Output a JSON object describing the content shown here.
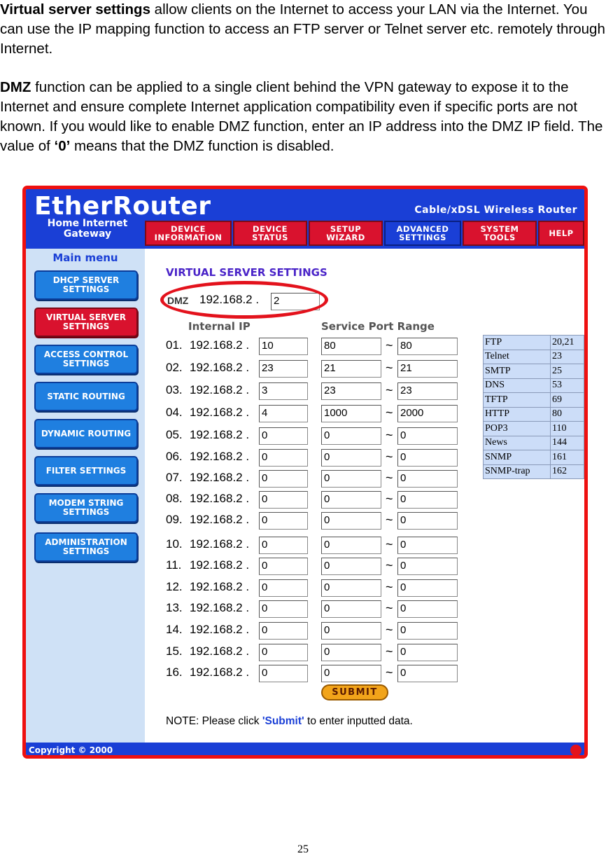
{
  "doc": {
    "p1_bold": "Virtual server settings",
    "p1_text": " allow clients on the Internet to access your LAN via the Internet. You can use the IP mapping function to access an FTP server or Telnet server etc. remotely through Internet.",
    "p2_bold": "DMZ",
    "p2_text": " function can be applied to a single client behind the VPN gateway to expose it to the Internet and ensure complete Internet application compatibility even if specific ports are not known. If you would like to enable DMZ function, enter an IP address into the DMZ IP field. The value of ",
    "p2_zero": "‘0’",
    "p2_tail": "  means that the DMZ function is disabled.",
    "page_number": "25"
  },
  "router": {
    "brand": "EtherRouter",
    "tagline": "Cable/xDSL Wireless Router",
    "home_gateway": "Home Internet Gateway",
    "nav": [
      {
        "label": "DEVICE INFORMATION"
      },
      {
        "label": "DEVICE STATUS"
      },
      {
        "label": "SETUP WIZARD"
      },
      {
        "label": "ADVANCED SETTINGS",
        "active": true
      },
      {
        "label": "SYSTEM TOOLS"
      },
      {
        "label": "HELP"
      }
    ],
    "main_menu_title": "Main menu",
    "menu": [
      {
        "label": "DHCP SERVER SETTINGS"
      },
      {
        "label": "VIRTUAL SERVER SETTINGS",
        "active": true
      },
      {
        "label": "ACCESS CONTROL SETTINGS"
      },
      {
        "label": "STATIC ROUTING"
      },
      {
        "label": "DYNAMIC ROUTING"
      },
      {
        "label": "FILTER SETTINGS"
      },
      {
        "label": "MODEM STRING SETTINGS"
      },
      {
        "label": "ADMINISTRATION SETTINGS"
      }
    ],
    "section_title": "VIRTUAL SERVER SETTINGS",
    "dmz": {
      "label": "DMZ",
      "prefix": "192.168.2 .",
      "value": "2"
    },
    "columns": {
      "internal_ip": "Internal IP",
      "port_range": "Service Port Range"
    },
    "rows": [
      {
        "num": "01.",
        "prefix": "192.168.2 .",
        "ip": "10",
        "start": "80",
        "end": "80"
      },
      {
        "num": "02.",
        "prefix": "192.168.2 .",
        "ip": "23",
        "start": "21",
        "end": "21"
      },
      {
        "num": "03.",
        "prefix": "192.168.2 .",
        "ip": "3",
        "start": "23",
        "end": "23"
      },
      {
        "num": "04.",
        "prefix": "192.168.2 .",
        "ip": "4",
        "start": "1000",
        "end": "2000"
      },
      {
        "num": "05.",
        "prefix": "192.168.2 .",
        "ip": "0",
        "start": "0",
        "end": "0"
      },
      {
        "num": "06.",
        "prefix": "192.168.2 .",
        "ip": "0",
        "start": "0",
        "end": "0"
      },
      {
        "num": "07.",
        "prefix": "192.168.2 .",
        "ip": "0",
        "start": "0",
        "end": "0"
      },
      {
        "num": "08.",
        "prefix": "192.168.2 .",
        "ip": "0",
        "start": "0",
        "end": "0"
      },
      {
        "num": "09.",
        "prefix": "192.168.2 .",
        "ip": "0",
        "start": "0",
        "end": "0"
      },
      {
        "num": "10.",
        "prefix": "192.168.2 .",
        "ip": "0",
        "start": "0",
        "end": "0"
      },
      {
        "num": "11.",
        "prefix": "192.168.2 .",
        "ip": "0",
        "start": "0",
        "end": "0"
      },
      {
        "num": "12.",
        "prefix": "192.168.2 .",
        "ip": "0",
        "start": "0",
        "end": "0"
      },
      {
        "num": "13.",
        "prefix": "192.168.2 .",
        "ip": "0",
        "start": "0",
        "end": "0"
      },
      {
        "num": "14.",
        "prefix": "192.168.2 .",
        "ip": "0",
        "start": "0",
        "end": "0"
      },
      {
        "num": "15.",
        "prefix": "192.168.2 .",
        "ip": "0",
        "start": "0",
        "end": "0"
      },
      {
        "num": "16.",
        "prefix": "192.168.2 .",
        "ip": "0",
        "start": "0",
        "end": "0"
      }
    ],
    "tilde": "~",
    "ports": [
      {
        "service": "FTP",
        "port": "20,21"
      },
      {
        "service": "Telnet",
        "port": "23"
      },
      {
        "service": "SMTP",
        "port": "25"
      },
      {
        "service": "DNS",
        "port": "53"
      },
      {
        "service": "TFTP",
        "port": "69"
      },
      {
        "service": "HTTP",
        "port": "80"
      },
      {
        "service": "POP3",
        "port": "110"
      },
      {
        "service": "News",
        "port": "144"
      },
      {
        "service": "SNMP",
        "port": "161"
      },
      {
        "service": "SNMP-trap",
        "port": "162"
      }
    ],
    "submit_label": "SUBMIT",
    "note_prefix": "NOTE: Please click ",
    "note_accent": "'Submit'",
    "note_suffix": " to enter inputted data.",
    "copyright": "Copyright © 2000"
  }
}
